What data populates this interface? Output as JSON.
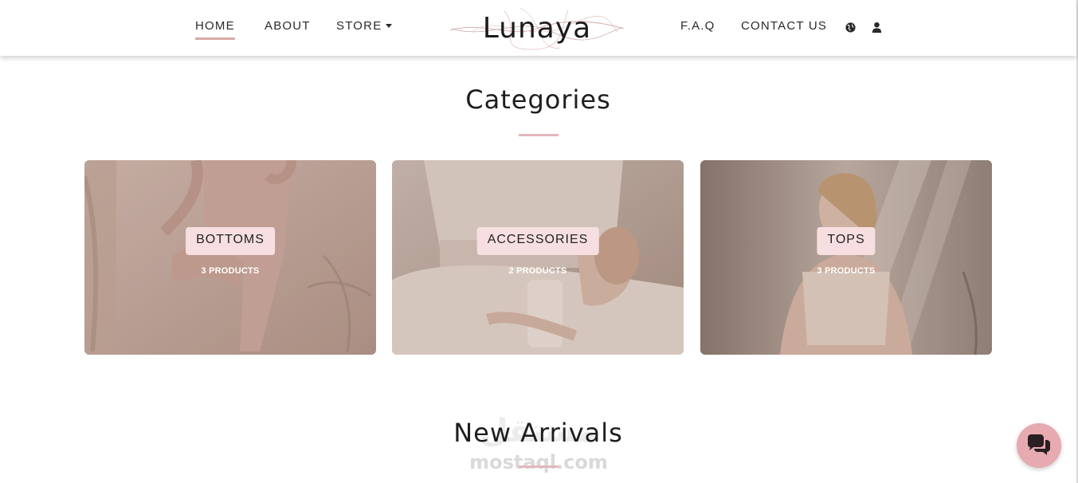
{
  "header": {
    "logo_text": "Lunaya",
    "nav_left": [
      {
        "label": "HOME",
        "active": true
      },
      {
        "label": "ABOUT",
        "active": false
      },
      {
        "label": "STORE",
        "active": false,
        "has_dropdown": true
      }
    ],
    "nav_right": [
      {
        "label": "F.A.Q"
      },
      {
        "label": "CONTACT US"
      }
    ],
    "icons": [
      "globe-icon",
      "user-icon"
    ]
  },
  "categories_section": {
    "title": "Categories",
    "cards": [
      {
        "label": "BOTTOMS",
        "count": "3 PRODUCTS"
      },
      {
        "label": "ACCESSORIES",
        "count": "2 PRODUCTS"
      },
      {
        "label": "TOPS",
        "count": "3 PRODUCTS"
      }
    ]
  },
  "new_arrivals_section": {
    "title": "New Arrivals"
  },
  "chat": {
    "icon": "chat-bubbles-icon"
  },
  "watermark": {
    "text": "mostaql.com",
    "arabic": "مستقل"
  },
  "colors": {
    "accent": "#d8aaa7",
    "underline": "#e4b7bd",
    "label_bg": "#f7dfe1",
    "chat_bg": "#e6aab0"
  }
}
